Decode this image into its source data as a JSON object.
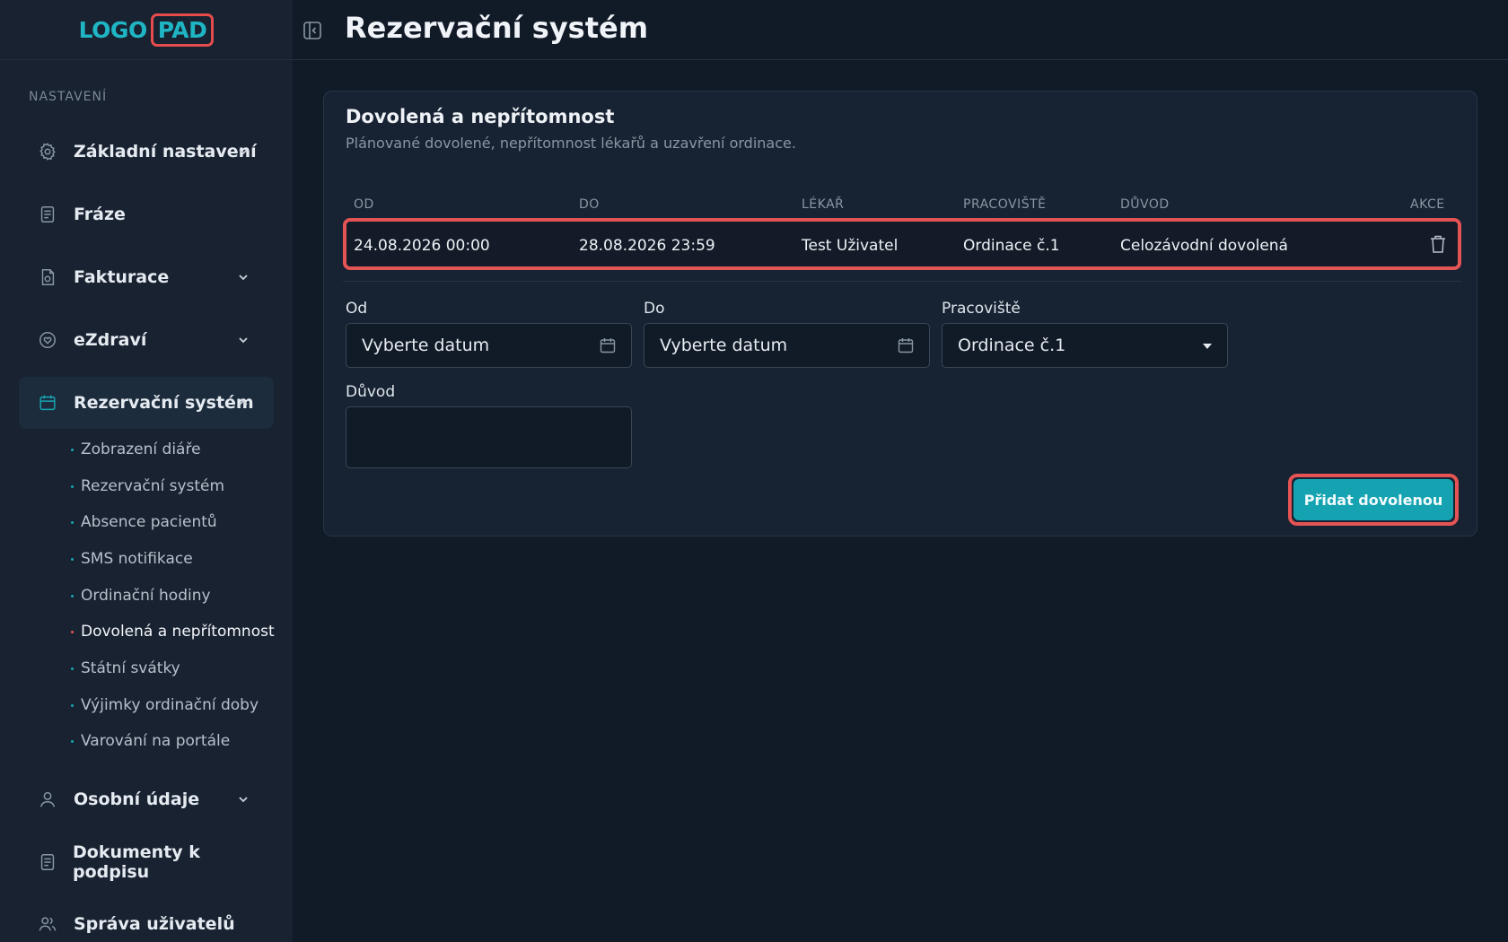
{
  "logo": {
    "part1": "LOGO",
    "part2": "PAD"
  },
  "page": {
    "title": "Rezervační systém"
  },
  "sidebar": {
    "section_title": "NASTAVENÍ",
    "items": [
      {
        "label": "Základní nastavení",
        "icon": "gear-icon"
      },
      {
        "label": "Fráze",
        "icon": "document-icon"
      },
      {
        "label": "Fakturace",
        "icon": "invoice-icon"
      },
      {
        "label": "eZdraví",
        "icon": "health-icon"
      },
      {
        "label": "Rezervační systém",
        "icon": "calendar-icon"
      },
      {
        "label": "Osobní údaje",
        "icon": "user-icon"
      },
      {
        "label": "Dokumenty k podpisu",
        "icon": "document-icon"
      },
      {
        "label": "Správa uživatelů",
        "icon": "users-icon"
      }
    ],
    "subitems": [
      {
        "label": "Zobrazení diáře"
      },
      {
        "label": "Rezervační systém"
      },
      {
        "label": "Absence pacientů"
      },
      {
        "label": "SMS notifikace"
      },
      {
        "label": "Ordinační hodiny"
      },
      {
        "label": "Dovolená a nepřítomnost"
      },
      {
        "label": "Státní svátky"
      },
      {
        "label": "Výjimky ordinační doby"
      },
      {
        "label": "Varování na portále"
      }
    ]
  },
  "card": {
    "title": "Dovolená a nepřítomnost",
    "subtitle": "Plánované dovolené, nepřítomnost lékařů a uzavření ordinace."
  },
  "table": {
    "headers": [
      "OD",
      "DO",
      "LÉKAŘ",
      "PRACOVIŠTĚ",
      "DŮVOD",
      "AKCE"
    ],
    "rows": [
      {
        "od": "24.08.2026 00:00",
        "do": "28.08.2026 23:59",
        "lekar": "Test Uživatel",
        "pracoviste": "Ordinace č.1",
        "duvod": "Celozávodní dovolená"
      }
    ]
  },
  "form": {
    "od_label": "Od",
    "od_placeholder": "Vyberte datum",
    "do_label": "Do",
    "do_placeholder": "Vyberte datum",
    "pracoviste_label": "Pracoviště",
    "pracoviste_value": "Ordinace č.1",
    "duvod_label": "Důvod",
    "duvod_value": "",
    "submit_label": "Přidat dovolenou"
  },
  "colors": {
    "accent": "#15a3b2",
    "highlight": "#e45454",
    "background": "#111a27",
    "sidebar": "#182231"
  }
}
